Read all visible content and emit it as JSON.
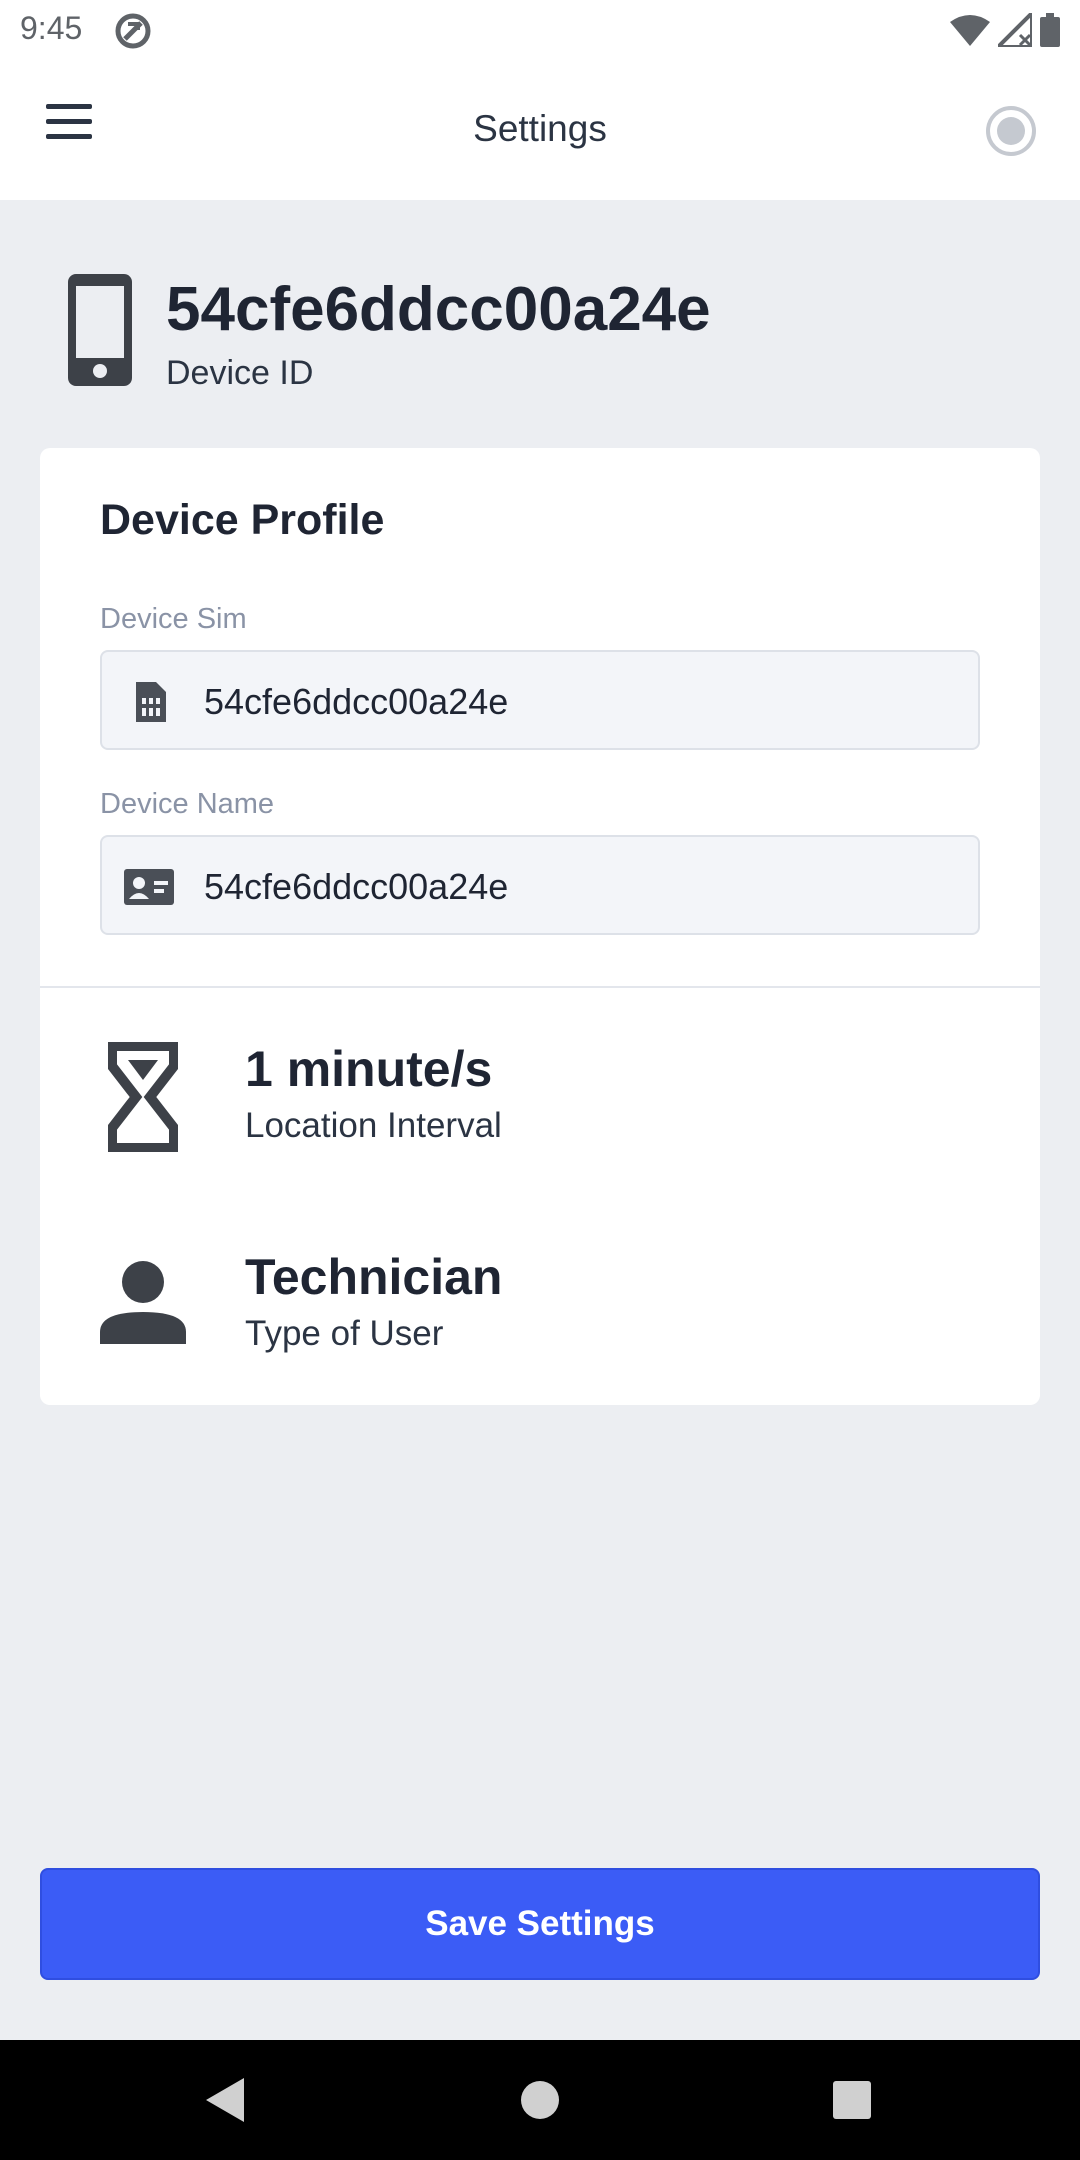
{
  "status_bar": {
    "time": "9:45",
    "icons": [
      "app-notification-icon",
      "wifi-icon",
      "signal-icon",
      "battery-icon"
    ]
  },
  "app_bar": {
    "title": "Settings",
    "menu_icon": "hamburger-menu-icon",
    "status_icon": "radio-status-icon"
  },
  "device": {
    "id_value": "54cfe6ddcc00a24e",
    "id_label": "Device ID",
    "icon": "smartphone-icon"
  },
  "profile": {
    "title": "Device Profile",
    "sim_label": "Device Sim",
    "sim_value": "54cfe6ddcc00a24e",
    "sim_icon": "sim-card-icon",
    "name_label": "Device Name",
    "name_value": "54cfe6ddcc00a24e",
    "name_icon": "contact-card-icon"
  },
  "location": {
    "value": "1 minute/s",
    "label": "Location Interval",
    "icon": "hourglass-icon"
  },
  "user": {
    "value": "Technician",
    "label": "Type of User",
    "icon": "person-icon"
  },
  "actions": {
    "save_label": "Save Settings"
  },
  "colors": {
    "primary": "#3b5cf6",
    "text_dark": "#1f2533",
    "background": "#eceef2"
  }
}
